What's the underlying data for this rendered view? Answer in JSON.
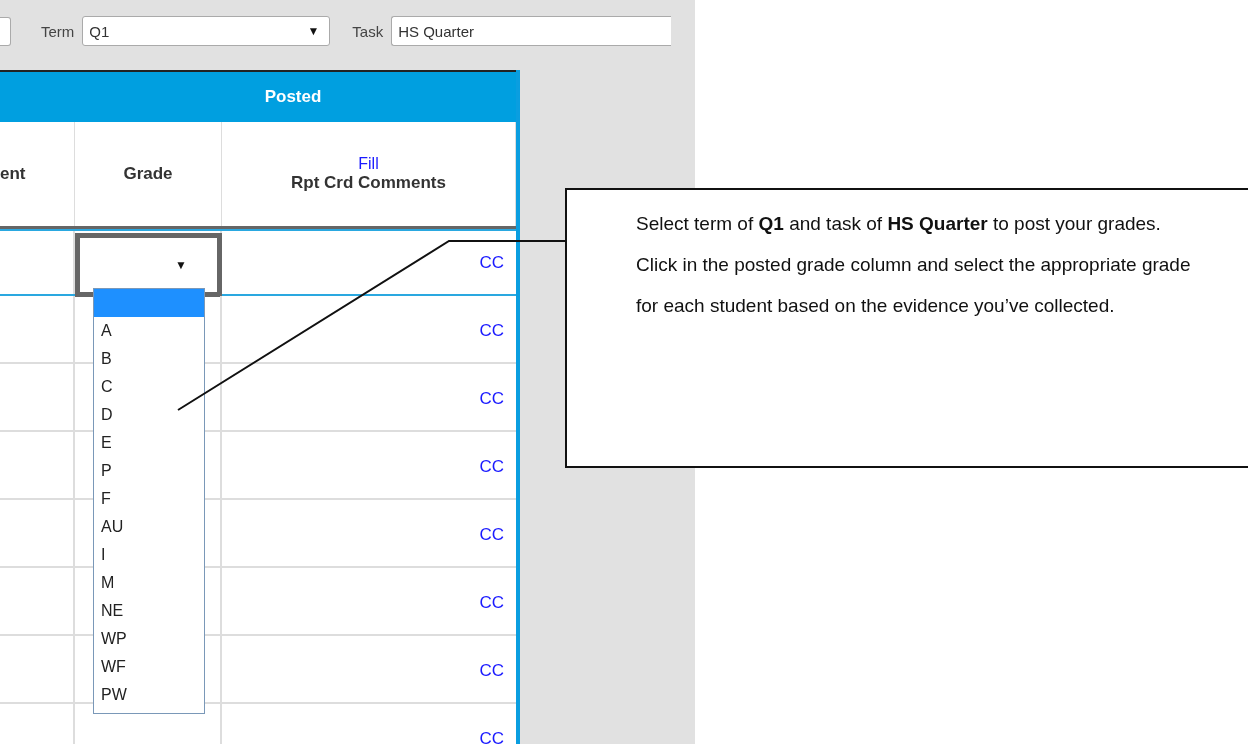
{
  "toolbar": {
    "term_label": "Term",
    "term_value": "Q1",
    "task_label": "Task",
    "task_value": "HS Quarter",
    "caret": "▼"
  },
  "table": {
    "group_header": "Posted",
    "columns": [
      {
        "label": "ent"
      },
      {
        "label": "Grade"
      },
      {
        "link": "Fill",
        "label": "Rpt Crd Comments"
      }
    ],
    "rows": [
      {
        "comment": "CC",
        "selected": true,
        "grade_caret": "▼"
      },
      {
        "comment": "CC",
        "selected": false
      },
      {
        "comment": "CC",
        "selected": false
      },
      {
        "comment": "CC",
        "selected": false
      },
      {
        "comment": "CC",
        "selected": false
      },
      {
        "comment": "CC",
        "selected": false
      },
      {
        "comment": "CC",
        "selected": false
      },
      {
        "comment": "CC",
        "selected": false
      }
    ]
  },
  "grade_dropdown": {
    "blank_option_selected": true,
    "options": [
      {
        "label": "A",
        "selected": false
      },
      {
        "label": "B",
        "selected": false
      },
      {
        "label": "C",
        "selected": false
      },
      {
        "label": "D",
        "selected": false
      },
      {
        "label": "E",
        "selected": false
      },
      {
        "label": "P",
        "selected": false
      },
      {
        "label": "F",
        "selected": false
      },
      {
        "label": "AU",
        "selected": false
      },
      {
        "label": "I",
        "selected": false
      },
      {
        "label": "M",
        "selected": false
      },
      {
        "label": "NE",
        "selected": false
      },
      {
        "label": "WP",
        "selected": false
      },
      {
        "label": "WF",
        "selected": false
      },
      {
        "label": "PW",
        "selected": false
      }
    ]
  },
  "callout": {
    "text": "Select term of **Q1** and task of **HS Quarter** to post your grades.  Click in the posted grade column and select the appropriate grade for each student based on the evidence you’ve collected."
  }
}
